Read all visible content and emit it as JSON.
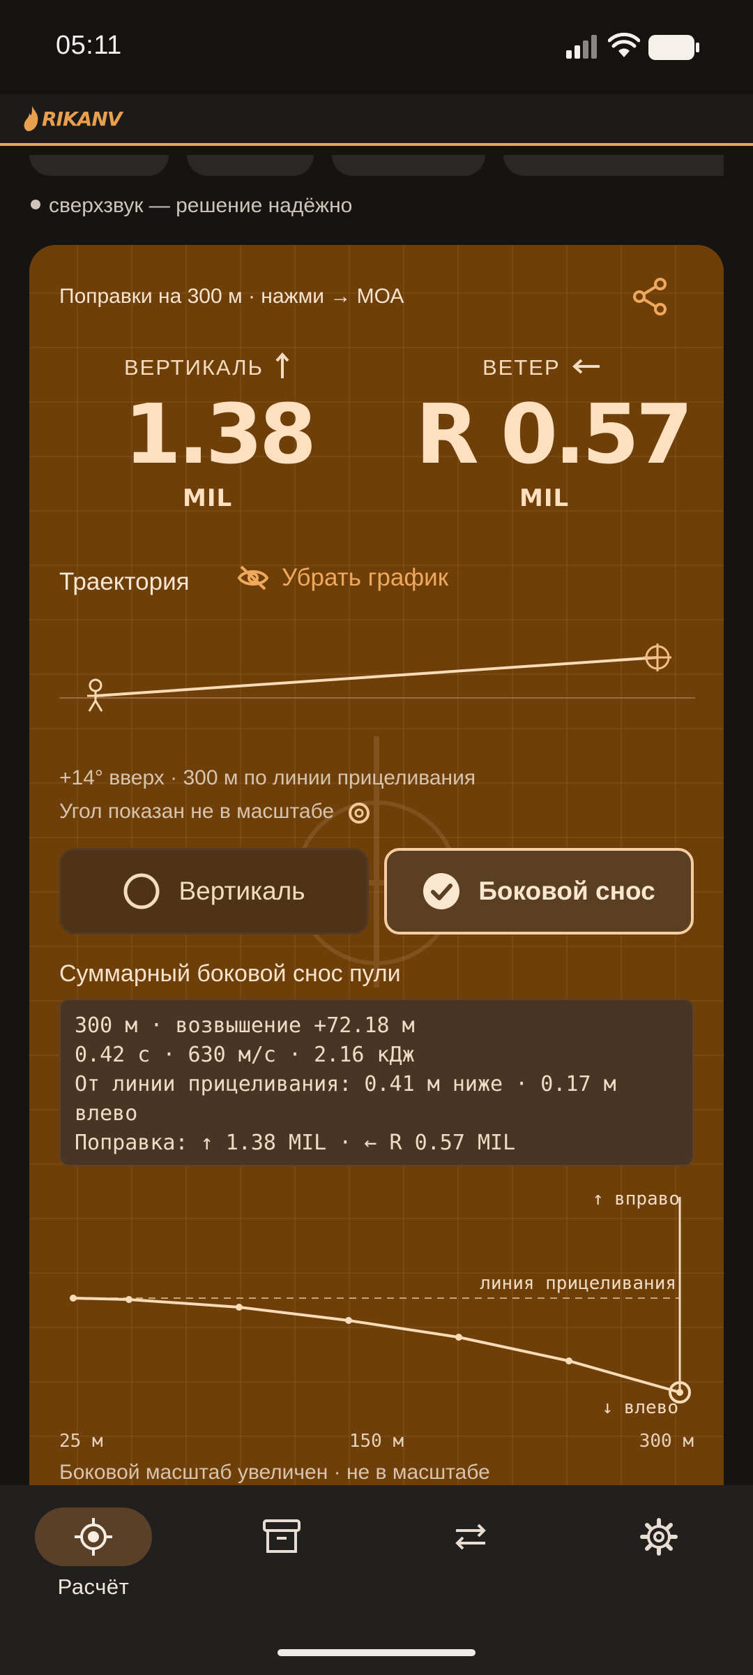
{
  "status_bar": {
    "time": "05:11"
  },
  "header": {
    "logo_text": "RIKANV"
  },
  "supersonic": {
    "text": "сверхзвук — решение надёжно"
  },
  "card": {
    "title": "Поправки на 300 м · нажми → МОА",
    "vertical": {
      "label": "ВЕРТИКАЛЬ",
      "value": "1.38",
      "unit": "MIL"
    },
    "wind": {
      "label": "ВЕТЕР",
      "value": "R 0.57",
      "unit": "MIL"
    },
    "trajectory_label": "Траектория",
    "hide_chart_label": "Убрать график",
    "angle_note": "+14° вверх · 300 м по линии прицеливания",
    "scale_note": "Угол показан не в масштабе",
    "toggles": {
      "vertical": "Вертикаль",
      "drift": "Боковой снос",
      "selected": "drift"
    },
    "drift_title": "Суммарный боковой снос пули",
    "info_lines": [
      "300 м · возвышение +72.18 м",
      "0.42 с · 630 м/с · 2.16 кДж",
      "От линии прицеливания: 0.41 м ниже · 0.17 м влево",
      "Поправка: ↑ 1.38 MIL · ← R 0.57 MIL"
    ],
    "drift_chart": {
      "up_label": "↑ вправо",
      "down_label": "↓ влево",
      "sight_line_label": "линия прицеливания",
      "x_labels": [
        "25 м",
        "150 м",
        "300 м"
      ]
    },
    "drift_note": "Боковой масштаб увеличен · не в масштабе"
  },
  "nav": {
    "calc_label": "Расчёт"
  },
  "colors": {
    "accent": "#e3a85c",
    "card_bg": "#6f3f0a",
    "nav_bg": "#22201e"
  }
}
